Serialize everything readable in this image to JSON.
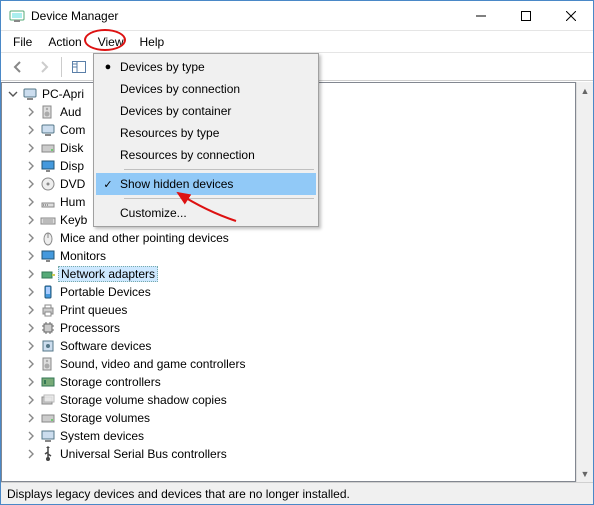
{
  "window": {
    "title": "Device Manager"
  },
  "menubar": {
    "file": "File",
    "action": "Action",
    "view": "View",
    "help": "Help"
  },
  "view_menu": {
    "by_type": "Devices by type",
    "by_connection": "Devices by connection",
    "by_container": "Devices by container",
    "res_by_type": "Resources by type",
    "res_by_conn": "Resources by connection",
    "show_hidden": "Show hidden devices",
    "customize": "Customize..."
  },
  "tree": {
    "root": "PC-Apri",
    "items": [
      {
        "label": "Aud"
      },
      {
        "label": "Com"
      },
      {
        "label": "Disk"
      },
      {
        "label": "Disp"
      },
      {
        "label": "DVD"
      },
      {
        "label": "Hum"
      },
      {
        "label": "Keyb"
      },
      {
        "label": "Mice and other pointing devices"
      },
      {
        "label": "Monitors"
      },
      {
        "label": "Network adapters"
      },
      {
        "label": "Portable Devices"
      },
      {
        "label": "Print queues"
      },
      {
        "label": "Processors"
      },
      {
        "label": "Software devices"
      },
      {
        "label": "Sound, video and game controllers"
      },
      {
        "label": "Storage controllers"
      },
      {
        "label": "Storage volume shadow copies"
      },
      {
        "label": "Storage volumes"
      },
      {
        "label": "System devices"
      },
      {
        "label": "Universal Serial Bus controllers"
      }
    ],
    "selected_index": 9
  },
  "statusbar": {
    "text": "Displays legacy devices and devices that are no longer installed."
  }
}
